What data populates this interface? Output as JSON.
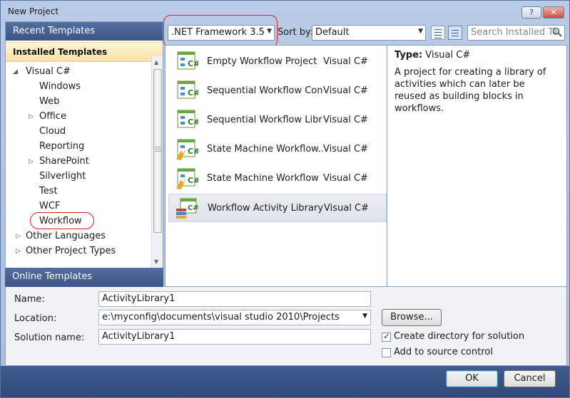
{
  "window": {
    "title": "New Project"
  },
  "titlebar": {
    "help": "?",
    "close": "✕"
  },
  "left": {
    "recent": "Recent Templates",
    "installed": "Installed Templates",
    "online": "Online Templates",
    "tree": [
      {
        "label": "Visual C#",
        "arrow": "◢"
      },
      {
        "label": "Windows"
      },
      {
        "label": "Web"
      },
      {
        "label": "Office",
        "arrow": "▷"
      },
      {
        "label": "Cloud"
      },
      {
        "label": "Reporting"
      },
      {
        "label": "SharePoint",
        "arrow": "▷"
      },
      {
        "label": "Silverlight"
      },
      {
        "label": "Test"
      },
      {
        "label": "WCF"
      },
      {
        "label": "Workflow"
      },
      {
        "label": "Other Languages",
        "arrow": "▷"
      },
      {
        "label": "Other Project Types",
        "arrow": "▷"
      }
    ]
  },
  "toolbar": {
    "framework": ".NET Framework 3.5",
    "sort_label": "Sort by:",
    "sort_value": "Default",
    "search_placeholder": "Search Installed Te"
  },
  "templates": [
    {
      "name": "Empty Workflow Project",
      "lang": "Visual C#"
    },
    {
      "name": "Sequential Workflow Cons...",
      "lang": "Visual C#"
    },
    {
      "name": "Sequential Workflow Libra...",
      "lang": "Visual C#"
    },
    {
      "name": "State Machine Workflow...",
      "lang": "Visual C#"
    },
    {
      "name": "State Machine Workflow L...",
      "lang": "Visual C#"
    },
    {
      "name": "Workflow Activity Library",
      "lang": "Visual C#",
      "selected": true
    }
  ],
  "description": {
    "type_label": "Type:",
    "type_value": "Visual C#",
    "text": "A project for creating a library of activities which can later be reused as building blocks in workflows."
  },
  "form": {
    "name_label": "Name:",
    "name_value": "ActivityLibrary1",
    "location_label": "Location:",
    "location_value": "e:\\myconfig\\documents\\visual studio 2010\\Projects",
    "solution_label": "Solution name:",
    "solution_value": "ActivityLibrary1",
    "browse": "Browse...",
    "create_dir": "Create directory for solution",
    "create_dir_checked": true,
    "add_source": "Add to source control",
    "add_source_checked": false
  },
  "footer": {
    "ok": "OK",
    "cancel": "Cancel"
  }
}
